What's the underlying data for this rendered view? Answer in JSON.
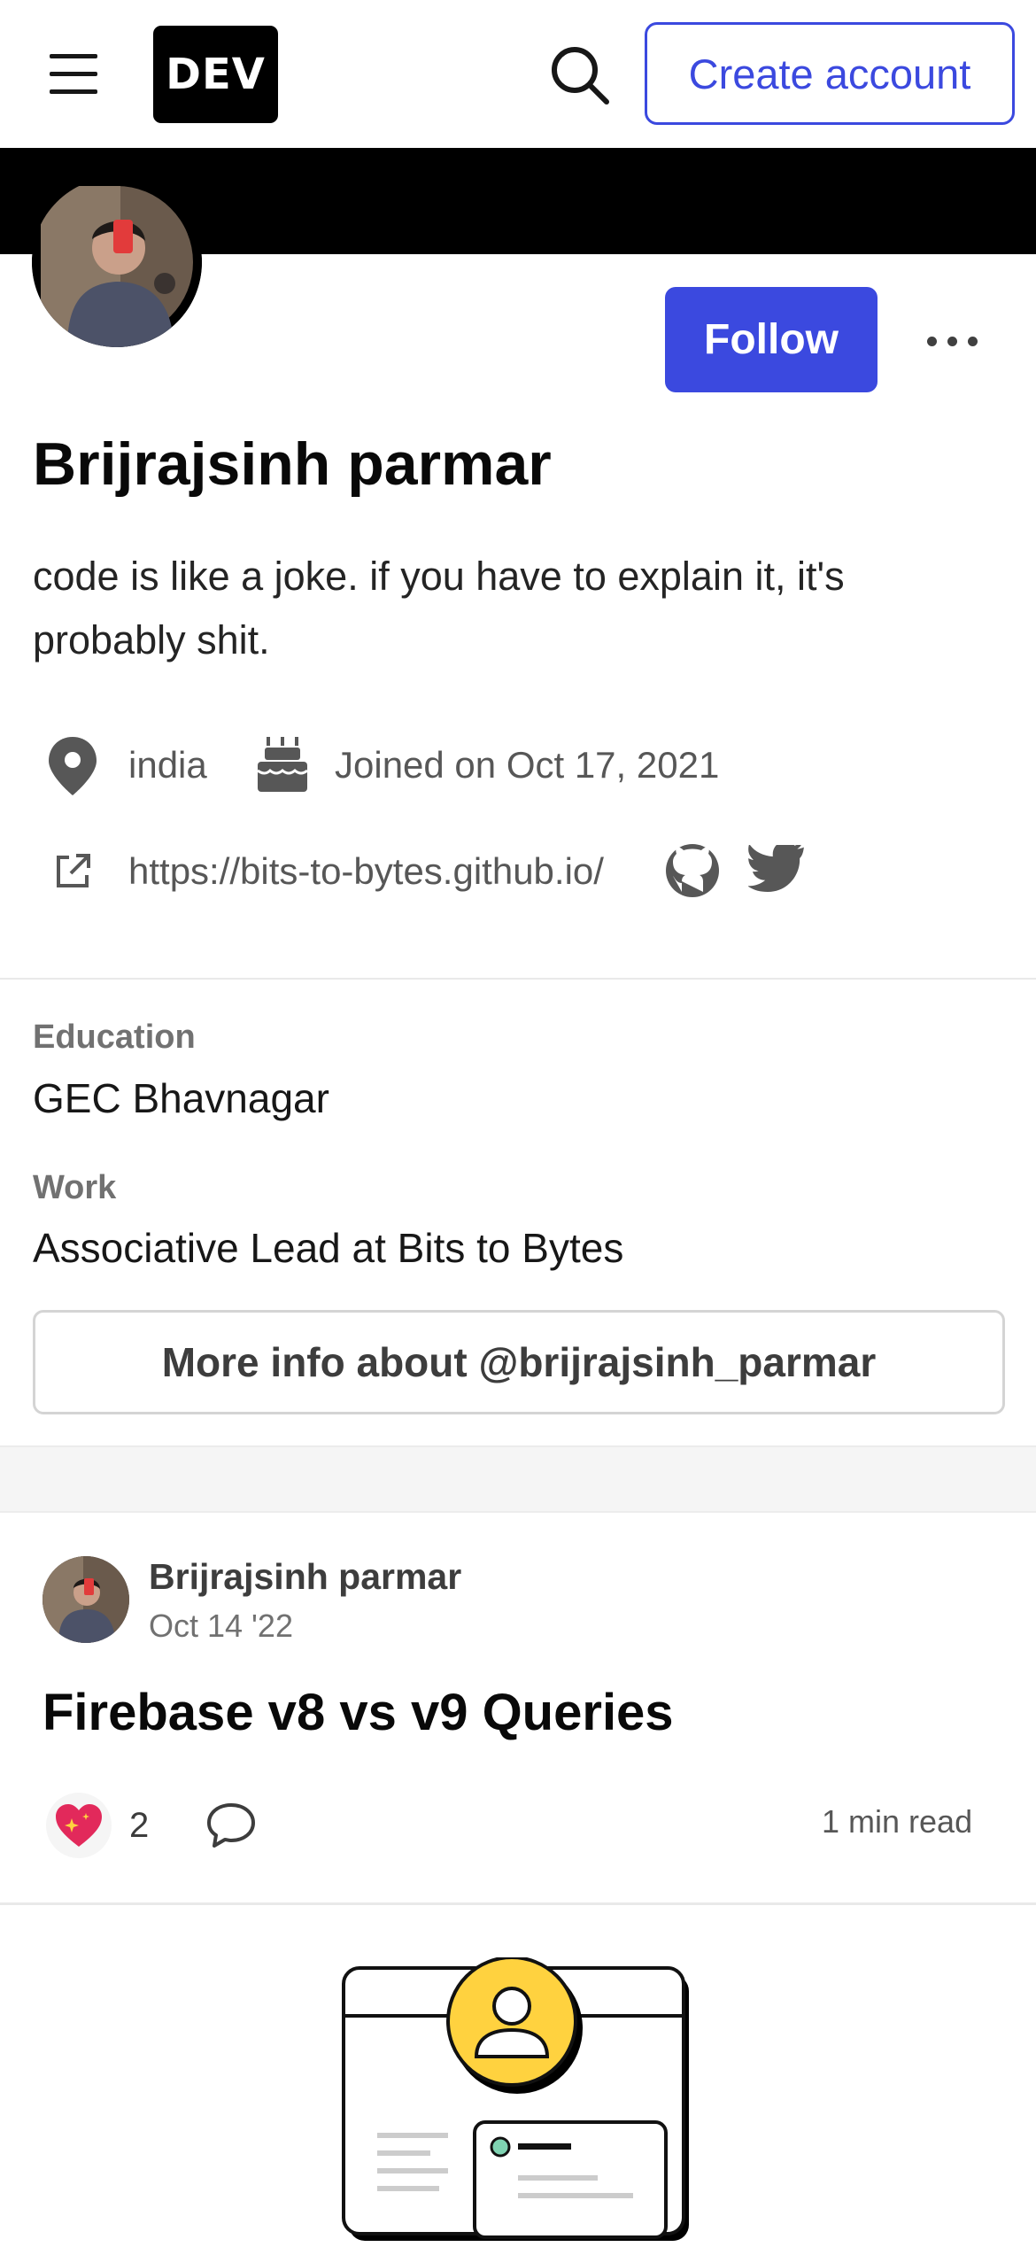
{
  "header": {
    "menu_icon": "hamburger-menu-icon",
    "logo_text": "DEV",
    "search_icon": "search-icon",
    "create_account_label": "Create account",
    "accent_color": "#3b49df"
  },
  "profile": {
    "follow_label": "Follow",
    "more_icon": "more-horizontal-icon",
    "name": "Brijrajsinh parmar",
    "bio": "code is like a joke. if you have to explain it, it's probably shit.",
    "location": "india",
    "joined": "Joined on Oct 17, 2021",
    "website": "https://bits-to-bytes.github.io/",
    "social_icons": [
      "github-icon",
      "twitter-icon"
    ]
  },
  "details": {
    "education_label": "Education",
    "education_value": "GEC Bhavnagar",
    "work_label": "Work",
    "work_value": "Associative Lead at Bits to Bytes",
    "more_info_label": "More info about @brijrajsinh_parmar"
  },
  "post": {
    "author": "Brijrajsinh parmar",
    "date": "Oct 14 '22",
    "title": "Firebase v8 vs v9 Queries",
    "reaction_count": "2",
    "read_time": "1 min read"
  }
}
